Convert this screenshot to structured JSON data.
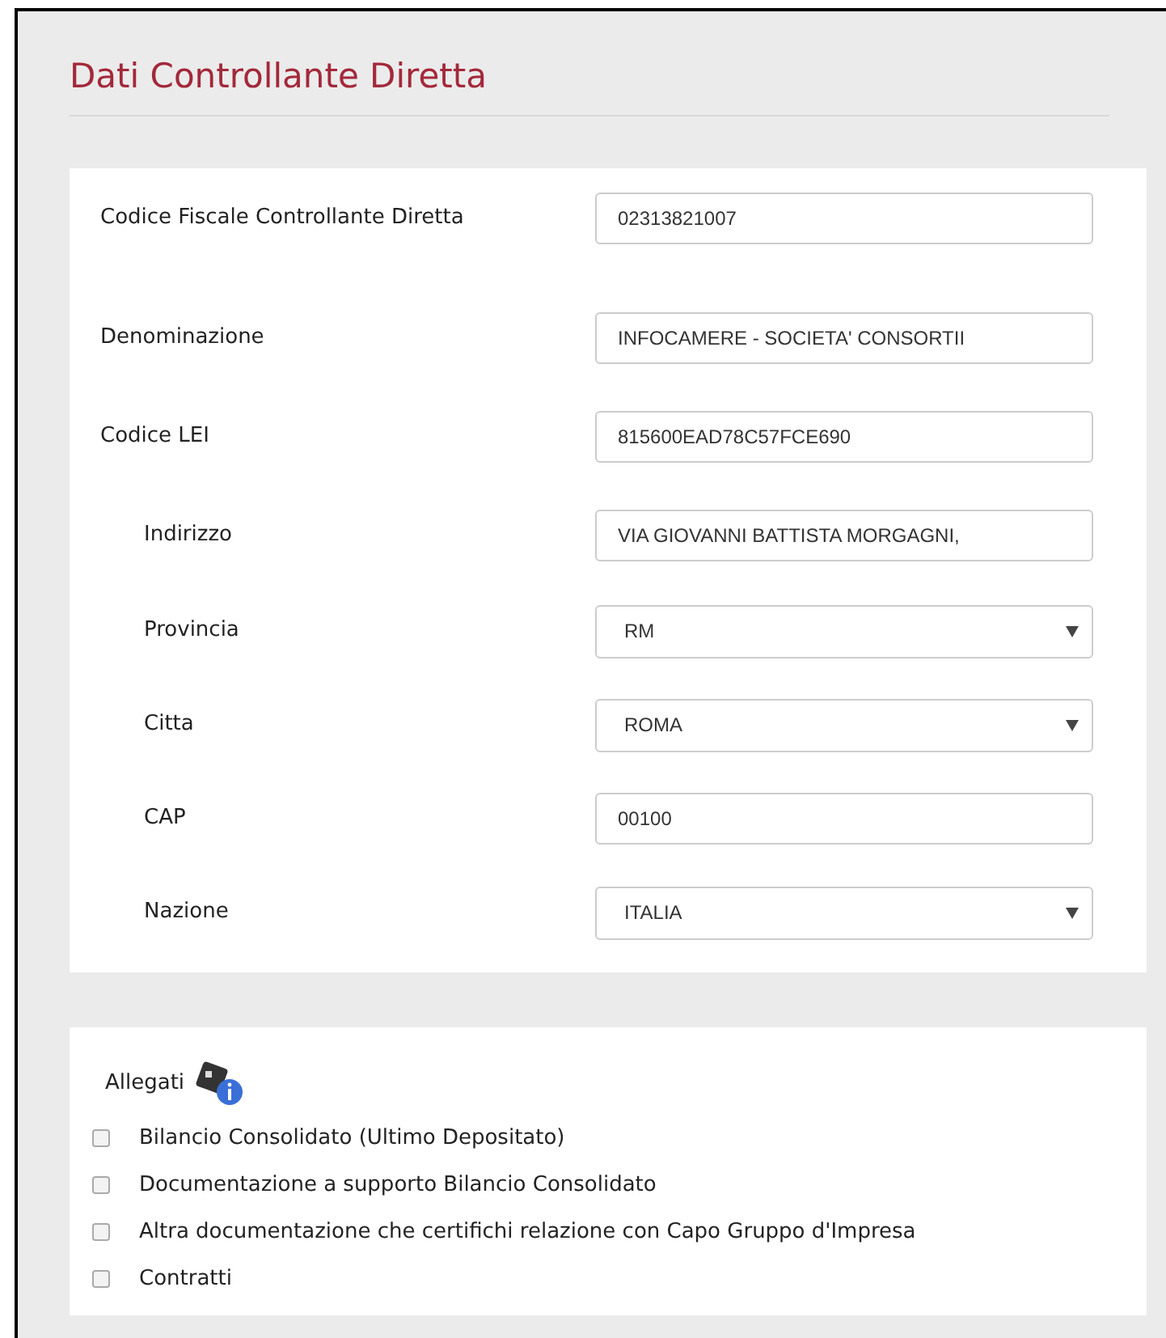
{
  "title": "Dati Controllante Diretta",
  "fields": [
    {
      "label": "Codice Fiscale Controllante Diretta",
      "kind": "text",
      "indented": false,
      "value": "02313821007"
    },
    {
      "label": "Denominazione",
      "kind": "text",
      "indented": false,
      "value": "INFOCAMERE - SOCIETA' CONSORTII"
    },
    {
      "label": "Codice LEI",
      "kind": "text",
      "indented": false,
      "value": "815600EAD78C57FCE690"
    },
    {
      "label": "Indirizzo",
      "kind": "text",
      "indented": true,
      "value": "VIA GIOVANNI BATTISTA MORGAGNI,"
    },
    {
      "label": "Provincia",
      "kind": "select",
      "indented": true,
      "value": "RM"
    },
    {
      "label": "Citta",
      "kind": "select",
      "indented": true,
      "value": "ROMA"
    },
    {
      "label": "CAP",
      "kind": "text",
      "indented": true,
      "value": "00100"
    },
    {
      "label": "Nazione",
      "kind": "select",
      "indented": true,
      "value": "ITALIA"
    }
  ],
  "attachments": {
    "title": "Allegati",
    "items": [
      {
        "label": "Bilancio Consolidato (Ultimo Depositato)",
        "checked": false
      },
      {
        "label": "Documentazione a supporto Bilancio Consolidato",
        "checked": false
      },
      {
        "label": "Altra documentazione che certifichi relazione con Capo Gruppo d'Impresa",
        "checked": false
      },
      {
        "label": "Contratti",
        "checked": false
      }
    ]
  }
}
